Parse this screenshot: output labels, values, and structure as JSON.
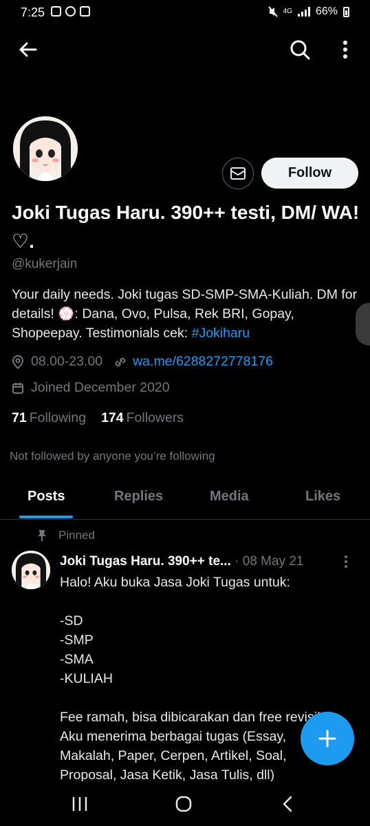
{
  "status_bar": {
    "time": "7:25",
    "network": "4G",
    "battery": "66%"
  },
  "profile": {
    "display_name": "Joki Tugas Haru. 390++ testi, DM/ WA!♡.",
    "handle": "@kukerjain",
    "bio_text": "Your daily needs. Joki tugas SD-SMP-SMA-Kuliah. DM for details! 💮: Dana, Ovo, Pulsa, Rek BRI, Gopay, Shopeepay. Testimonials cek: ",
    "bio_hashtag": "#Jokiharu",
    "location": "08.00-23.00",
    "website": "wa.me/6288272778176",
    "joined": "Joined December 2020",
    "following_count": "71",
    "following_label": "Following",
    "followers_count": "174",
    "followers_label": "Followers",
    "not_followed": "Not followed by anyone you’re following",
    "follow_label": "Follow"
  },
  "tabs": [
    {
      "label": "Posts",
      "active": true
    },
    {
      "label": "Replies"
    },
    {
      "label": "Media"
    },
    {
      "label": "Likes"
    }
  ],
  "pinned_post": {
    "pinned_label": "Pinned",
    "author": "Joki Tugas Haru. 390++ te...",
    "date": "· 08 May 21",
    "body": "Halo! Aku buka Jasa Joki Tugas untuk:\n\n-SD\n-SMP\n-SMA\n-KULIAH\n\nFee ramah, bisa dibicarakan dan free revisi!\nAku menerima berbagai tugas (Essay,\nMakalah, Paper, Cerpen, Artikel, Soal,\nProposal, Jasa Ketik, Jasa Tulis, dll)"
  },
  "icons": {
    "back": "arrow-left-icon",
    "search": "search-icon",
    "more": "more-vertical-icon",
    "message": "mail-icon",
    "location": "location-icon",
    "link": "link-icon",
    "calendar": "calendar-icon",
    "pin": "pin-icon",
    "compose": "plus-icon"
  },
  "colors": {
    "accent": "#1d9bf0",
    "muted": "#71767b",
    "background": "#000000"
  }
}
